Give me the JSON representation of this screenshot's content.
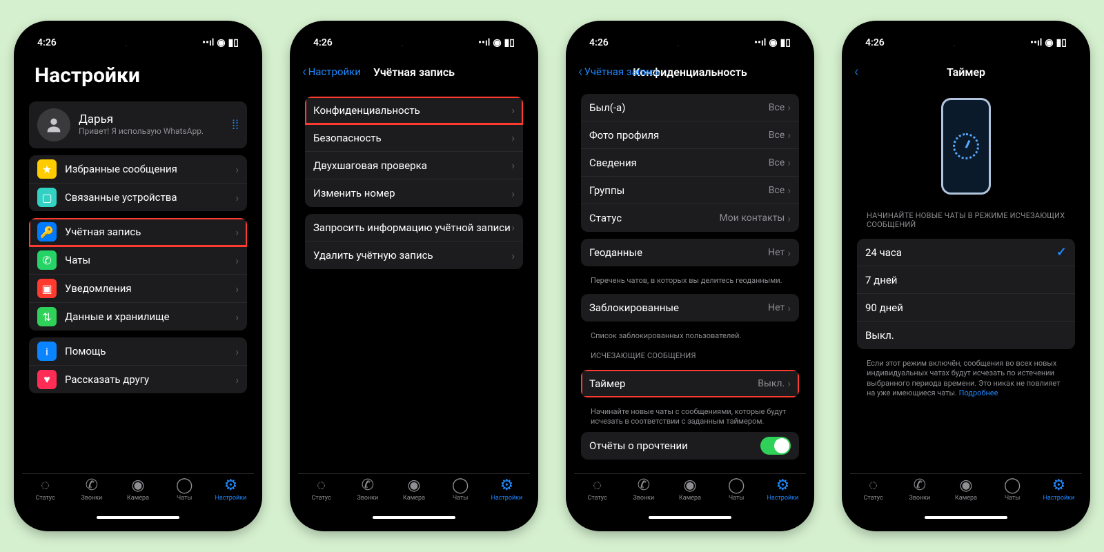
{
  "status": {
    "time": "4:26"
  },
  "tabs": {
    "status": "Статус",
    "calls": "Звонки",
    "camera": "Камера",
    "chats": "Чаты",
    "settings": "Настройки"
  },
  "screen1": {
    "title": "Настройки",
    "profile": {
      "name": "Дарья",
      "sub": "Привет! Я использую WhatsApp."
    },
    "rows": {
      "starred": "Избранные сообщения",
      "linked": "Связанные устройства",
      "account": "Учётная запись",
      "chats": "Чаты",
      "notifications": "Уведомления",
      "storage": "Данные и хранилище",
      "help": "Помощь",
      "tell": "Рассказать другу"
    }
  },
  "screen2": {
    "back": "Настройки",
    "title": "Учётная запись",
    "rows": {
      "privacy": "Конфиденциальность",
      "security": "Безопасность",
      "twostep": "Двухшаговая проверка",
      "change": "Изменить номер",
      "request": "Запросить информацию учётной записи",
      "delete": "Удалить учётную запись"
    }
  },
  "screen3": {
    "back": "Учётная запись",
    "title": "Конфиденциальность",
    "rows": {
      "lastseen": {
        "label": "Был(-а)",
        "value": "Все"
      },
      "photo": {
        "label": "Фото профиля",
        "value": "Все"
      },
      "about": {
        "label": "Сведения",
        "value": "Все"
      },
      "groups": {
        "label": "Группы",
        "value": "Все"
      },
      "status": {
        "label": "Статус",
        "value": "Мои контакты"
      },
      "geo": {
        "label": "Геоданные",
        "value": "Нет"
      },
      "geo_footer": "Перечень чатов, в которых вы делитесь геоданными.",
      "blocked": {
        "label": "Заблокированные",
        "value": "Нет"
      },
      "blocked_footer": "Список заблокированных пользователей.",
      "disappear_header": "ИСЧЕЗАЮЩИЕ СООБЩЕНИЯ",
      "timer": {
        "label": "Таймер",
        "value": "Выкл."
      },
      "timer_footer": "Начинайте новые чаты с сообщениями, которые будут исчезать в соответствии с заданным таймером.",
      "read": "Отчёты о прочтении"
    }
  },
  "screen4": {
    "title": "Таймер",
    "header": "НАЧИНАЙТЕ НОВЫЕ ЧАТЫ В РЕЖИМЕ ИСЧЕЗАЮЩИХ СООБЩЕНИЙ",
    "options": {
      "h24": "24 часа",
      "d7": "7 дней",
      "d90": "90 дней",
      "off": "Выкл."
    },
    "footer": "Если этот режим включён, сообщения во всех новых индивидуальных чатах будут исчезать по истечении выбранного периода времени. Это никак не повлияет на уже имеющиеся чаты.",
    "more": "Подробнее"
  }
}
